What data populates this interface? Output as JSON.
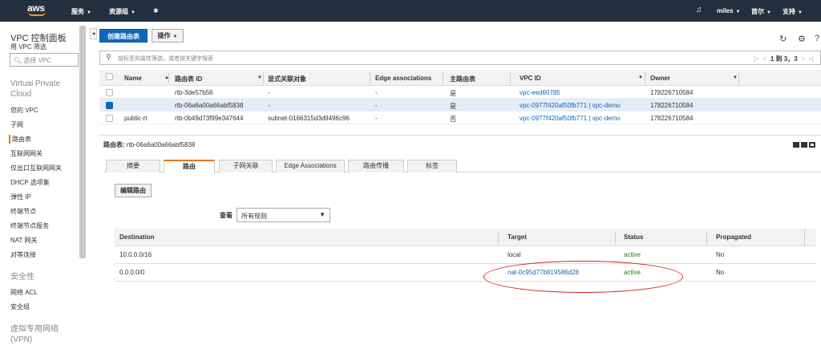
{
  "topnav": {
    "logo": "aws",
    "services": "服务",
    "resource_groups": "资源组",
    "user": "miles",
    "region": "首尔",
    "support": "支持"
  },
  "sidebar": {
    "title": "VPC 控制面板",
    "filter_label": "用 VPC 筛选",
    "select_placeholder": "选择 VPC",
    "section_vpc": "Virtual Private Cloud",
    "items": [
      "您的 VPC",
      "子网",
      "路由表",
      "互联网网关",
      "仅出口互联网网关",
      "DHCP 选项集",
      "弹性 IP",
      "终端节点",
      "终端节点服务",
      "NAT 网关",
      "对等连接"
    ],
    "section_security": "安全性",
    "security_items": [
      "网络 ACL",
      "安全组"
    ],
    "section_vpn": "虚拟专用网络 (VPN)"
  },
  "toolbar": {
    "create_label": "创建路由表",
    "actions_label": "操作"
  },
  "filter": {
    "placeholder": "按标签和属性筛选，或者按关键字搜索",
    "pagination": "1 到 3，3"
  },
  "route_tables": {
    "columns": [
      "Name",
      "路由表 ID",
      "显式关联对象",
      "Edge associations",
      "主路由表",
      "VPC ID",
      "Owner"
    ],
    "rows": [
      {
        "name": "",
        "id": "rtb-3de57b56",
        "assoc": "-",
        "edge": "-",
        "main": "是",
        "vpc": "vpc-eed60785",
        "owner": "178226710584",
        "selected": false
      },
      {
        "name": "",
        "id": "rtb-06a6a00a66abf5838",
        "assoc": "-",
        "edge": "-",
        "main": "是",
        "vpc": "vpc-0977f420af50fb771 | vpc-demo",
        "owner": "178226710584",
        "selected": true
      },
      {
        "name": "public-rt",
        "id": "rtb-0b49d73f99e347644",
        "assoc": "subnet-0166315d3d9496c96",
        "edge": "-",
        "main": "否",
        "vpc": "vpc-0977f420af50fb771 | vpc-demo",
        "owner": "178226710584",
        "selected": false
      }
    ]
  },
  "detail": {
    "label": "路由表:",
    "id": "rtb-06a6a00a66abf5838",
    "tabs": [
      "摘要",
      "路由",
      "子网关联",
      "Edge Associations",
      "路由传播",
      "标签"
    ],
    "active_tab": "路由",
    "edit_routes_label": "编辑路由",
    "view_label": "查看",
    "view_value": "所有规则"
  },
  "routes": {
    "columns": [
      "Destination",
      "Target",
      "Status",
      "Propagated"
    ],
    "rows": [
      {
        "destination": "10.0.0.0/16",
        "target": "local",
        "status": "active",
        "propagated": "No",
        "target_link": false
      },
      {
        "destination": "0.0.0.0/0",
        "target": "nat-0c95d77b819586d28",
        "status": "active",
        "propagated": "No",
        "target_link": true
      }
    ]
  },
  "colors": {
    "nav_bg": "#232f3e",
    "primary": "#1166bb",
    "accent": "#e47911",
    "status_active": "#1d8102",
    "annotation": "#d62121"
  }
}
